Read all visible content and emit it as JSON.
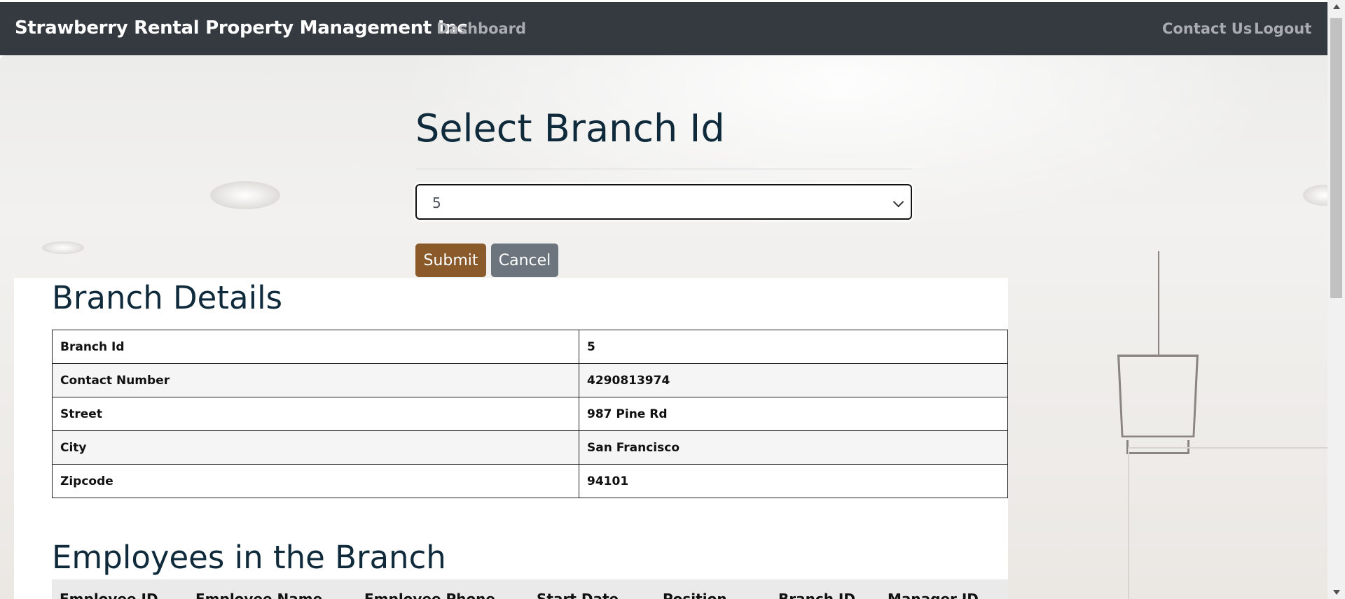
{
  "navbar": {
    "brand": "Strawberry Rental Property Management Inc",
    "dashboard": "Dashboard",
    "contact": "Contact Us",
    "logout": "Logout"
  },
  "form": {
    "title": "Select Branch Id",
    "selected_value": "5",
    "submit_label": "Submit",
    "cancel_label": "Cancel"
  },
  "branch_details": {
    "title": "Branch Details",
    "rows": [
      {
        "label": "Branch Id",
        "value": "5"
      },
      {
        "label": "Contact Number",
        "value": "4290813974"
      },
      {
        "label": "Street",
        "value": "987 Pine Rd"
      },
      {
        "label": "City",
        "value": "San Francisco"
      },
      {
        "label": "Zipcode",
        "value": "94101"
      }
    ]
  },
  "employees": {
    "title": "Employees in the Branch",
    "columns": [
      "Employee ID",
      "Employee Name",
      "Employee Phone",
      "Start Date",
      "Position",
      "Branch ID",
      "Manager ID"
    ]
  },
  "colors": {
    "navbar": "#343a40",
    "heading": "#0e2a3b",
    "submit": "#8b5a2b",
    "cancel": "#6c757d"
  }
}
